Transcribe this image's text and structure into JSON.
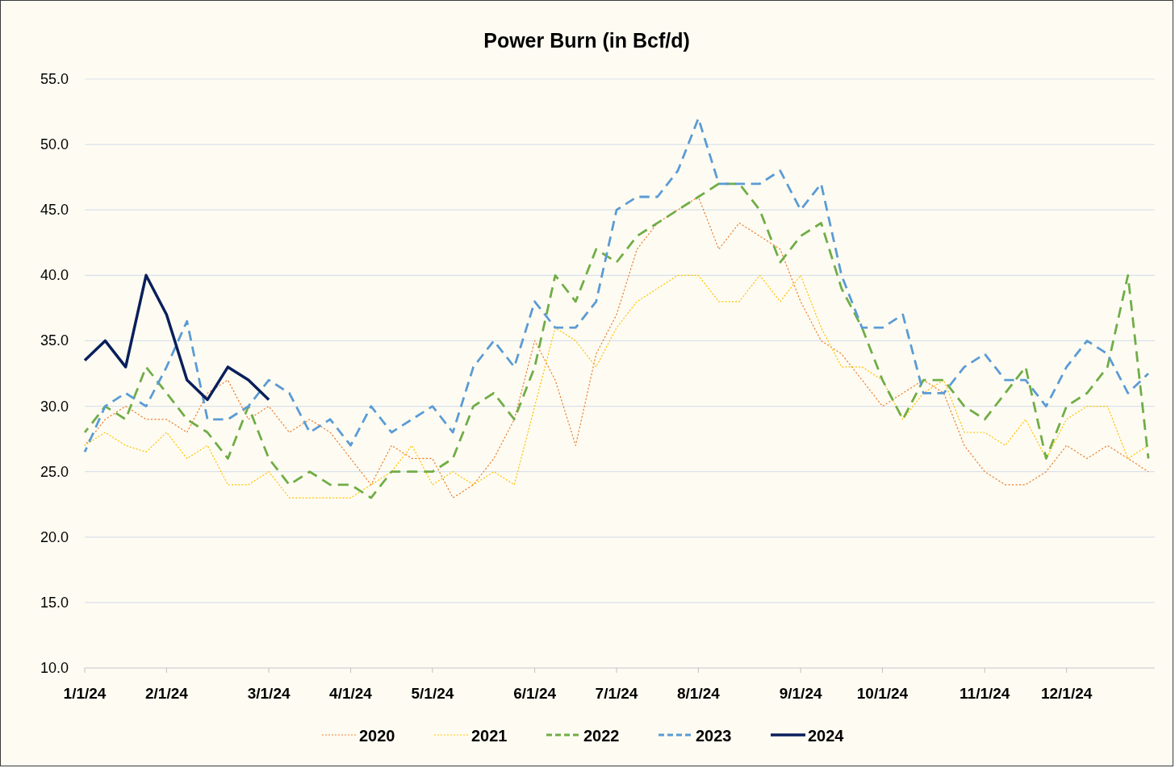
{
  "chart_data": {
    "type": "line",
    "title": "Power Burn (in Bcf/d)",
    "categories": [
      "1/1/24",
      null,
      null,
      null,
      "2/1/24",
      null,
      null,
      null,
      null,
      "3/1/24",
      null,
      null,
      null,
      "4/1/24",
      null,
      null,
      null,
      "5/1/24",
      null,
      null,
      null,
      null,
      "6/1/24",
      null,
      null,
      null,
      "7/1/24",
      null,
      null,
      null,
      "8/1/24",
      null,
      null,
      null,
      null,
      "9/1/24",
      null,
      null,
      null,
      "10/1/24",
      null,
      null,
      null,
      null,
      "11/1/24",
      null,
      null,
      null,
      "12/1/24",
      null,
      null,
      null,
      null
    ],
    "ylim": [
      10,
      55
    ],
    "grid": true,
    "legend": true,
    "yticks": [
      {
        "value": 10,
        "label": "10.0"
      },
      {
        "value": 15,
        "label": "15.0"
      },
      {
        "value": 20,
        "label": "20.0"
      },
      {
        "value": 25,
        "label": "25.0"
      },
      {
        "value": 30,
        "label": "30.0"
      },
      {
        "value": 35,
        "label": "35.0"
      },
      {
        "value": 40,
        "label": "40.0"
      },
      {
        "value": 45,
        "label": "45.0"
      },
      {
        "value": 50,
        "label": "50.0"
      },
      {
        "value": 55,
        "label": "55.0"
      }
    ],
    "series": [
      {
        "name": "2020",
        "color": "#ed7d31",
        "line_style": "dotted",
        "values": [
          27,
          29,
          30,
          29,
          29,
          28,
          31,
          32,
          29,
          30,
          28,
          29,
          28,
          26,
          24,
          27,
          26,
          26,
          23,
          24,
          26,
          29,
          35,
          32,
          27,
          34,
          37,
          42,
          44,
          45,
          46,
          42,
          44,
          43,
          42,
          38,
          35,
          34,
          32,
          30,
          31,
          32,
          31,
          27,
          25,
          24,
          24,
          25,
          27,
          26,
          27,
          26,
          25
        ]
      },
      {
        "name": "2021",
        "color": "#ffc000",
        "line_style": "dotted",
        "values": [
          27,
          28,
          27,
          26.5,
          28,
          26,
          27,
          24,
          24,
          25,
          23,
          23,
          23,
          23,
          24,
          25,
          27,
          24,
          25,
          24,
          25,
          24,
          30,
          36,
          35,
          33,
          36,
          38,
          39,
          40,
          40,
          38,
          38,
          40,
          38,
          40,
          36,
          33,
          33,
          32,
          29,
          31,
          32,
          28,
          28,
          27,
          29,
          26,
          29,
          30,
          30,
          26,
          27
        ]
      },
      {
        "name": "2022",
        "color": "#70ad47",
        "line_style": "dashed",
        "values": [
          28,
          30,
          29,
          33,
          31,
          29,
          28,
          26,
          30,
          26,
          24,
          25,
          24,
          24,
          23,
          25,
          25,
          25,
          26,
          30,
          31,
          29,
          33,
          40,
          38,
          42,
          41,
          43,
          44,
          45,
          46,
          47,
          47,
          45,
          41,
          43,
          44,
          39,
          36,
          32,
          29,
          32,
          32,
          30,
          29,
          31,
          33,
          26,
          30,
          31,
          33,
          40,
          26
        ]
      },
      {
        "name": "2023",
        "color": "#5b9bd5",
        "line_style": "dashed",
        "values": [
          26.5,
          30,
          31,
          30,
          33,
          36.5,
          29,
          29,
          30,
          32,
          31,
          28,
          29,
          27,
          30,
          28,
          29,
          30,
          28,
          33,
          35,
          33,
          38,
          36,
          36,
          38,
          45,
          46,
          46,
          48,
          52,
          47,
          47,
          47,
          48,
          45,
          47,
          40,
          36,
          36,
          37,
          31,
          31,
          33,
          34,
          32,
          32,
          30,
          33,
          35,
          34,
          31,
          32.5
        ]
      },
      {
        "name": "2024",
        "color": "#0a1f5c",
        "line_style": "solid",
        "values": [
          33.5,
          35,
          33,
          40,
          37,
          32,
          30.5,
          33,
          32,
          30.5,
          null,
          null,
          null,
          null,
          null,
          null,
          null,
          null,
          null,
          null,
          null,
          null,
          null,
          null,
          null,
          null,
          null,
          null,
          null,
          null,
          null,
          null,
          null,
          null,
          null,
          null,
          null,
          null,
          null,
          null,
          null,
          null,
          null,
          null,
          null,
          null,
          null,
          null,
          null,
          null,
          null,
          null,
          null
        ]
      }
    ]
  }
}
